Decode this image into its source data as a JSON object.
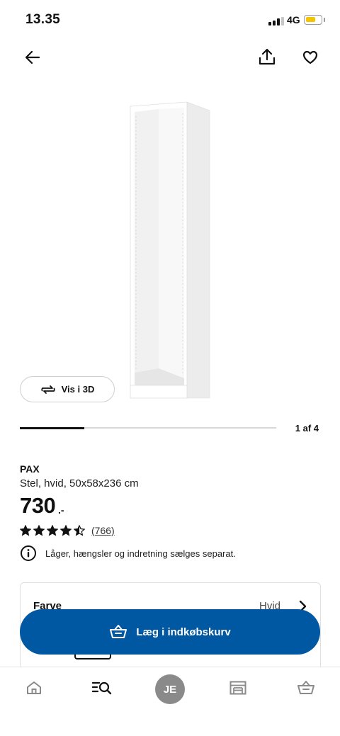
{
  "status_bar": {
    "time": "13.35",
    "network": "4G",
    "battery_color": "#f5c400",
    "signal_bars_filled": 3,
    "signal_bars_total": 4
  },
  "nav": {
    "back_icon": "arrow-left-icon",
    "share_icon": "share-icon",
    "favorite_icon": "heart-icon"
  },
  "gallery": {
    "view_3d_label": "Vis i 3D",
    "page_indicator": "1 af 4",
    "progress_fraction": 0.25
  },
  "product": {
    "name": "PAX",
    "description": "Stel, hvid, 50x58x236 cm",
    "price": "730",
    "price_suffix": ".-",
    "rating_stars": 4.5,
    "rating_count": "(766)",
    "info_note": "Låger, hængsler og indretning sælges separat."
  },
  "variant": {
    "label": "Farve",
    "value": "Hvid"
  },
  "cart_button": {
    "label": "Læg i indkøbskurv",
    "color": "#0058a3"
  },
  "tabbar": {
    "home_icon": "home-icon",
    "search_icon": "search-icon",
    "avatar_initials": "JE",
    "store_icon": "store-icon",
    "basket_icon": "basket-icon"
  }
}
